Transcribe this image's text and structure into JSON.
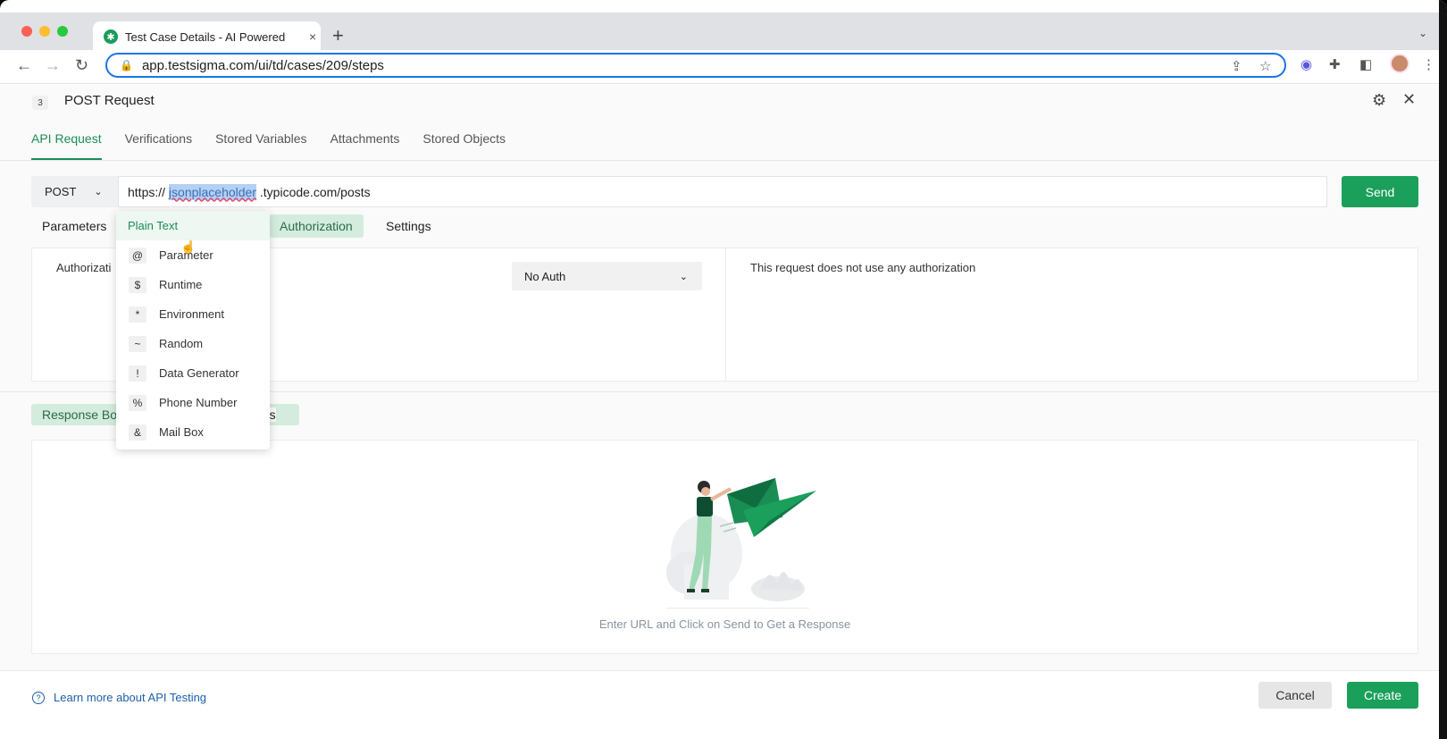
{
  "browser": {
    "tab_title": "Test Case Details - AI Powered",
    "tab_close": "×",
    "new_tab": "+",
    "url": "app.testsigma.com/ui/td/cases/209/steps"
  },
  "step": {
    "number": "3",
    "title": "POST Request"
  },
  "main_tabs": [
    "API Request",
    "Verifications",
    "Stored Variables",
    "Attachments",
    "Stored Objects"
  ],
  "request": {
    "method": "POST",
    "url_prefix": "https:// ",
    "url_highlight": "jsonplaceholder",
    "url_suffix": " .typicode.com/posts",
    "send_label": "Send"
  },
  "sub_tabs": [
    "Parameters",
    "Authorization",
    "Settings"
  ],
  "auth": {
    "label": "Authorizati",
    "type_value": "No Auth",
    "message": "This request does not use any authorization"
  },
  "response": {
    "tab_label": "Response Bo",
    "tab2_partial": "tus",
    "empty_message": "Enter URL and Click on Send to Get a Response"
  },
  "dropdown": {
    "items": [
      {
        "symbol": "",
        "label": "Plain Text"
      },
      {
        "symbol": "@",
        "label": "Parameter"
      },
      {
        "symbol": "$",
        "label": "Runtime"
      },
      {
        "symbol": "*",
        "label": "Environment"
      },
      {
        "symbol": "~",
        "label": "Random"
      },
      {
        "symbol": "!",
        "label": "Data Generator"
      },
      {
        "symbol": "%",
        "label": "Phone Number"
      },
      {
        "symbol": "&",
        "label": "Mail Box"
      }
    ]
  },
  "footer": {
    "learn_more": "Learn more about API Testing",
    "cancel_label": "Cancel",
    "create_label": "Create"
  },
  "colors": {
    "accent": "#1aa05b",
    "active_tab_bg": "#d4ecdd",
    "link": "#1e5fa8"
  }
}
